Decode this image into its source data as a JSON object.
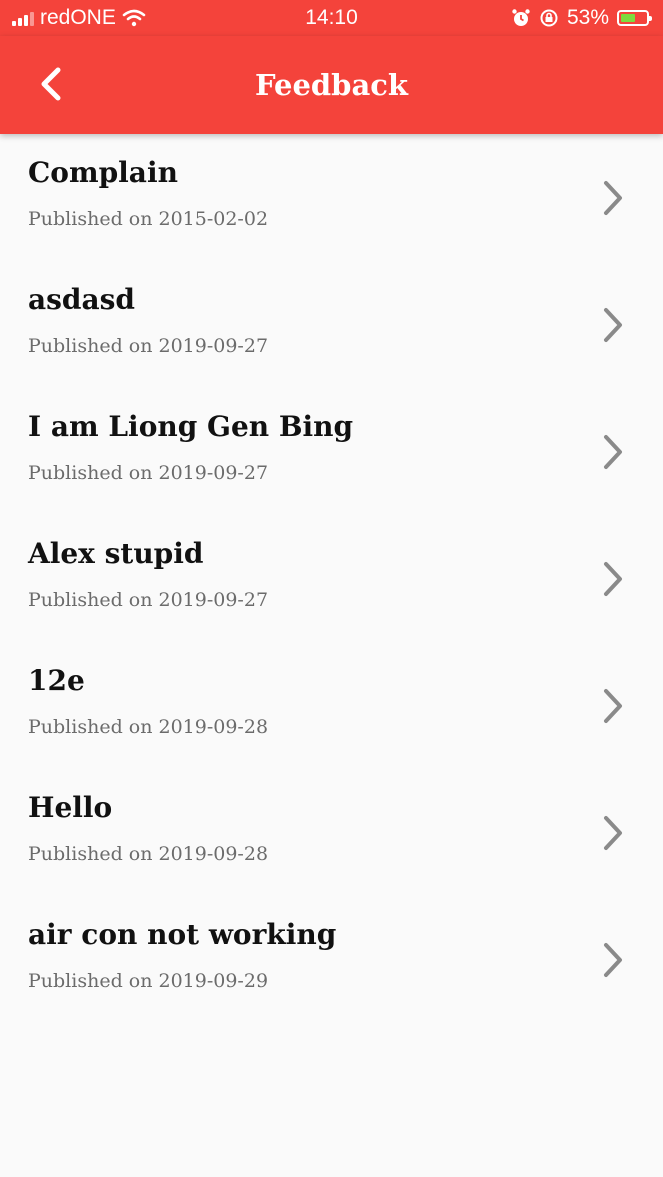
{
  "status_bar": {
    "carrier": "redONE",
    "time": "14:10",
    "battery_percent": "53%",
    "battery_level": 0.53,
    "icons": [
      "signal-icon",
      "wifi-icon",
      "alarm-icon",
      "rotation-lock-icon",
      "battery-icon"
    ]
  },
  "header": {
    "title": "Feedback",
    "back_icon": "chevron-left-icon"
  },
  "feedback_list": [
    {
      "title": "Complain",
      "date": "Published on 2015-02-02"
    },
    {
      "title": "asdasd",
      "date": "Published on 2019-09-27"
    },
    {
      "title": "I am Liong Gen Bing",
      "date": "Published on 2019-09-27"
    },
    {
      "title": "Alex stupid",
      "date": "Published on 2019-09-27"
    },
    {
      "title": "12e",
      "date": "Published on 2019-09-28"
    },
    {
      "title": "Hello",
      "date": "Published on 2019-09-28"
    },
    {
      "title": "air con not working",
      "date": "Published on 2019-09-29"
    }
  ],
  "colors": {
    "accent": "#f4433b",
    "background": "#fafafa",
    "title_text": "#111111",
    "date_text": "#6b6b6b",
    "chevron": "#8a8a8a"
  }
}
